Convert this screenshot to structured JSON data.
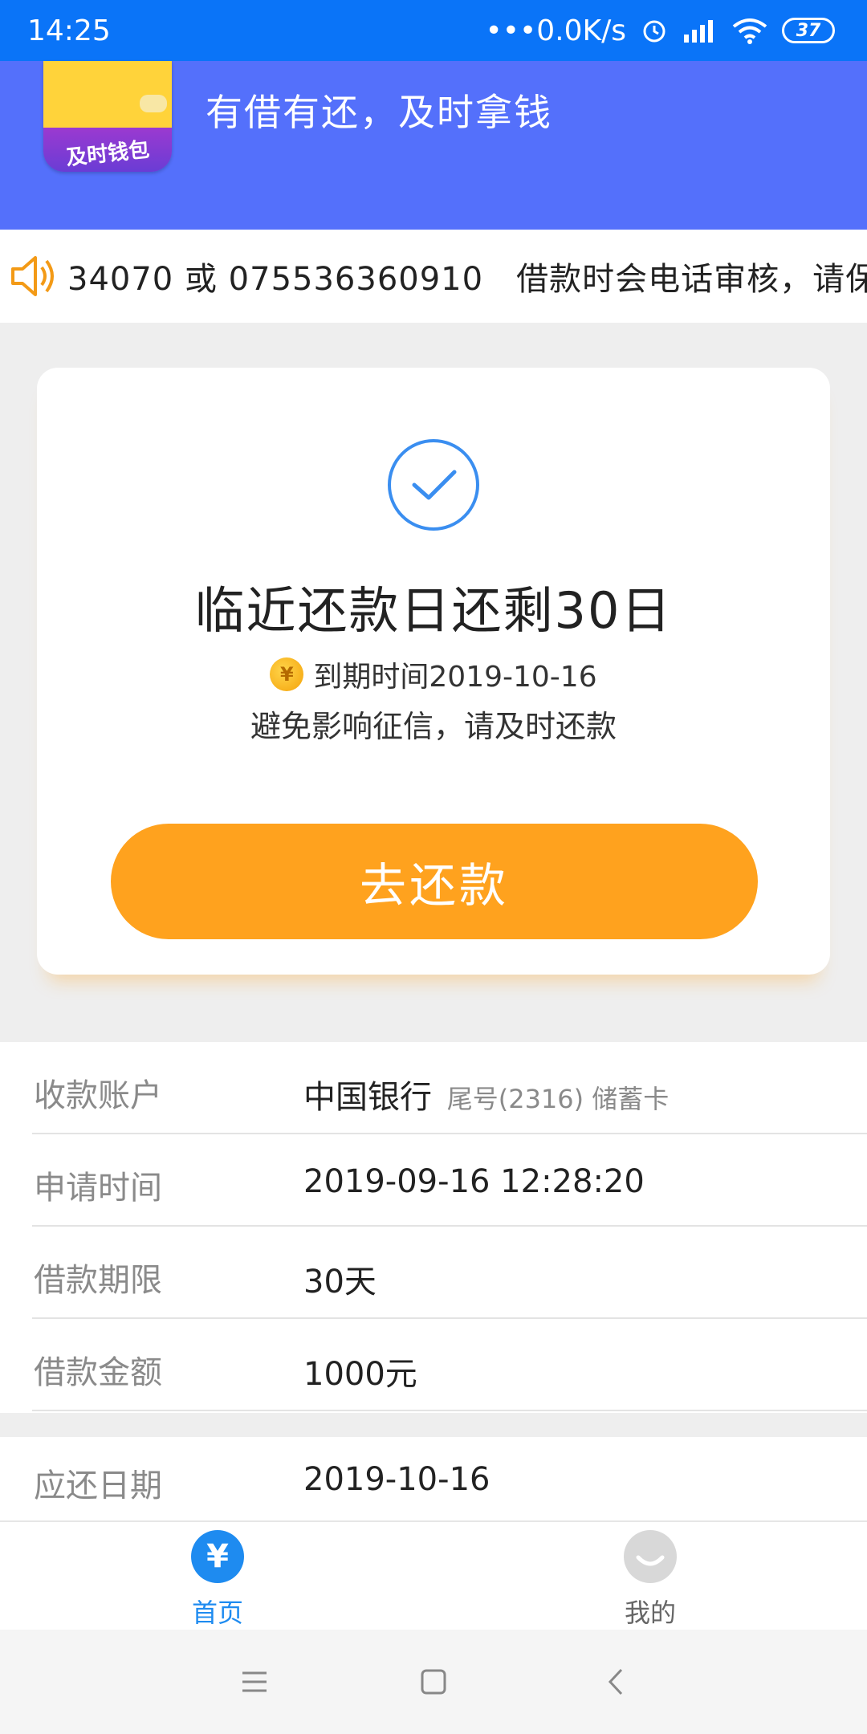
{
  "status_bar": {
    "time": "14:25",
    "network_speed": "•••0.0K/s",
    "battery": "37",
    "icons": [
      "alarm-icon",
      "signal-icon",
      "wifi-icon",
      "battery-icon"
    ]
  },
  "header": {
    "logo_text": "及时钱包",
    "slogan": "有借有还，及时拿钱",
    "bg_color": "#5470fb"
  },
  "notice": {
    "icon": "speaker-icon",
    "text": "34070 或 075536360910　借款时会电话审核，请保"
  },
  "card": {
    "icon": "check-circle-icon",
    "title": "临近还款日还剩30日",
    "coin_symbol": "¥",
    "due_text": "到期时间2019-10-16",
    "note": "避免影响征信，请及时还款",
    "button_label": "去还款",
    "button_color": "#ffa21e"
  },
  "info": {
    "rows": [
      {
        "label": "收款账户",
        "value": "中国银行",
        "sub": "尾号(2316) 储蓄卡"
      },
      {
        "label": "申请时间",
        "value": "2019-09-16 12:28:20",
        "sub": ""
      },
      {
        "label": "借款期限",
        "value": "30天",
        "sub": ""
      },
      {
        "label": "借款金额",
        "value": "1000元",
        "sub": ""
      }
    ],
    "due_row": {
      "label": "应还日期",
      "value": "2019-10-16"
    }
  },
  "tabbar": {
    "home": {
      "icon": "yen-icon",
      "icon_glyph": "¥",
      "label": "首页"
    },
    "mine": {
      "icon": "smile-icon",
      "label": "我的"
    }
  },
  "system_nav": [
    "menu-icon",
    "home-square-icon",
    "back-icon"
  ]
}
